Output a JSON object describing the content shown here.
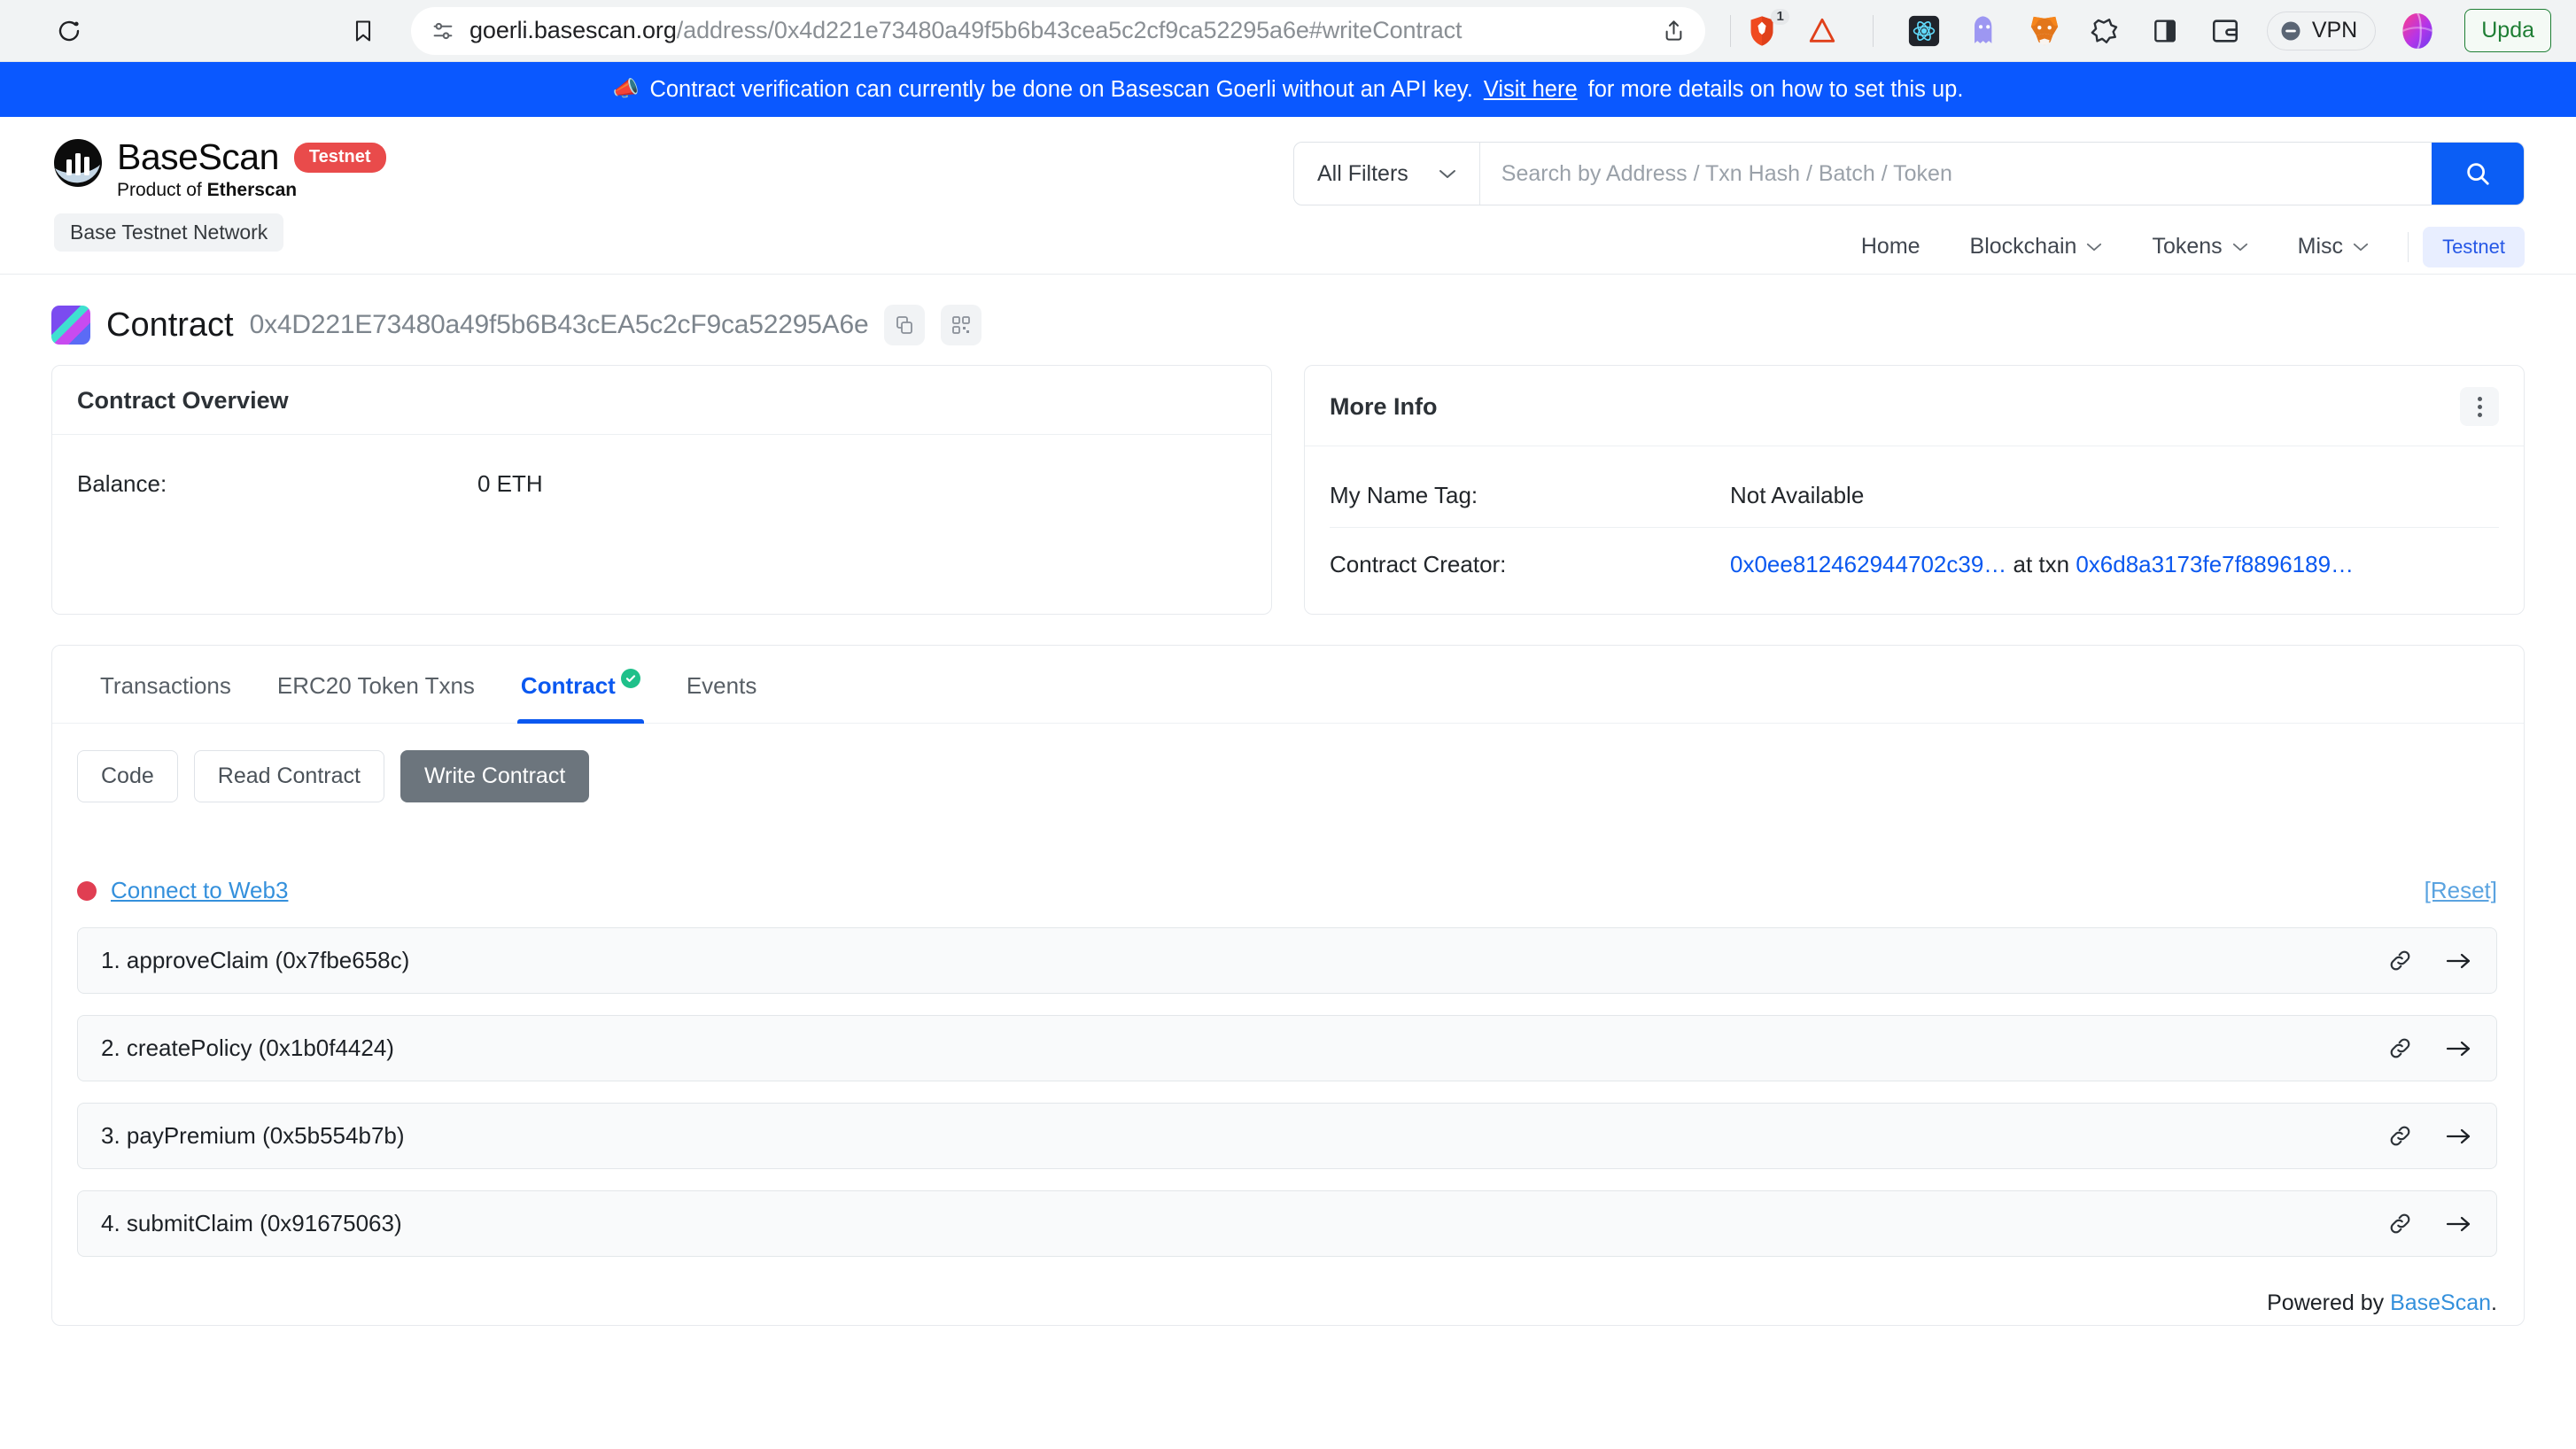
{
  "browser": {
    "url_host": "goerli.basescan.org",
    "url_path": "/address/0x4d221e73480a49f5b6b43cea5c2cf9ca52295a6e#writeContract",
    "reload_icon": "reload-icon",
    "bookmark_icon": "bookmark-icon",
    "tune_icon": "tune-icon",
    "share_icon": "share-icon",
    "brave_badge_count": "1",
    "vpn_label": "VPN",
    "update_label": "Upda",
    "extensions": [
      {
        "name": "react-devtools-icon"
      },
      {
        "name": "ghost-extension-icon"
      },
      {
        "name": "metamask-icon"
      },
      {
        "name": "rabby-wallet-icon"
      },
      {
        "name": "sidebar-panel-icon"
      },
      {
        "name": "wallet-card-icon"
      }
    ]
  },
  "notice": {
    "icon": "megaphone-icon",
    "text_before": "Contract verification can currently be done on Basescan Goerli without an API key.",
    "link": "Visit here",
    "text_after": "for more details on how to set this up."
  },
  "header": {
    "brand_name": "BaseScan",
    "brand_badge": "Testnet",
    "brand_sub_prefix": "Product of ",
    "brand_sub_bold": "Etherscan",
    "network_chip": "Base Testnet Network",
    "search": {
      "filter_label": "All Filters",
      "placeholder": "Search by Address / Txn Hash / Batch / Token",
      "value": "",
      "search_icon": "search-icon"
    },
    "nav": [
      {
        "label": "Home",
        "caret": false
      },
      {
        "label": "Blockchain",
        "caret": true
      },
      {
        "label": "Tokens",
        "caret": true
      },
      {
        "label": "Misc",
        "caret": true
      }
    ],
    "nav_testnet": "Testnet"
  },
  "page_title": {
    "label": "Contract",
    "address": "0x4D221E73480a49f5b6B43cEA5c2cF9ca52295A6e",
    "copy_icon": "copy-icon",
    "qr_icon": "qr-code-icon"
  },
  "overview_card": {
    "title": "Contract Overview",
    "rows": [
      {
        "key": "Balance:",
        "value": "0 ETH"
      }
    ]
  },
  "more_info_card": {
    "title": "More Info",
    "kebab_icon": "more-options-icon",
    "name_tag_key": "My Name Tag:",
    "name_tag_value": "Not Available",
    "creator_key": "Contract Creator:",
    "creator_address": "0x0ee812462944702c39…",
    "creator_mid": " at txn ",
    "creator_txn": "0x6d8a3173fe7f8896189…"
  },
  "tabs": [
    {
      "label": "Transactions",
      "active": false,
      "verified": false
    },
    {
      "label": "ERC20 Token Txns",
      "active": false,
      "verified": false
    },
    {
      "label": "Contract",
      "active": true,
      "verified": true
    },
    {
      "label": "Events",
      "active": false,
      "verified": false
    }
  ],
  "sub_tabs": [
    {
      "label": "Code",
      "active": false
    },
    {
      "label": "Read Contract",
      "active": false
    },
    {
      "label": "Write Contract",
      "active": true
    }
  ],
  "connect": {
    "label": "Connect to Web3",
    "status_color": "#e03e52",
    "reset_label": "[Reset]"
  },
  "functions": [
    {
      "label": "1. approveClaim (0x7fbe658c)",
      "link_icon": "link-icon",
      "expand_icon": "arrow-right-icon"
    },
    {
      "label": "2. createPolicy (0x1b0f4424)",
      "link_icon": "link-icon",
      "expand_icon": "arrow-right-icon"
    },
    {
      "label": "3. payPremium (0x5b554b7b)",
      "link_icon": "link-icon",
      "expand_icon": "arrow-right-icon"
    },
    {
      "label": "4. submitClaim (0x91675063)",
      "link_icon": "link-icon",
      "expand_icon": "arrow-right-icon"
    }
  ],
  "footer": {
    "prefix": "Powered by ",
    "link": "BaseScan",
    "suffix": "."
  },
  "colors": {
    "accent_blue": "#0a58f0",
    "banner_blue": "#0a58ff",
    "testnet_red": "#e94b4b",
    "verified_green": "#1fc08a",
    "active_seg_gray": "#6c757d"
  }
}
